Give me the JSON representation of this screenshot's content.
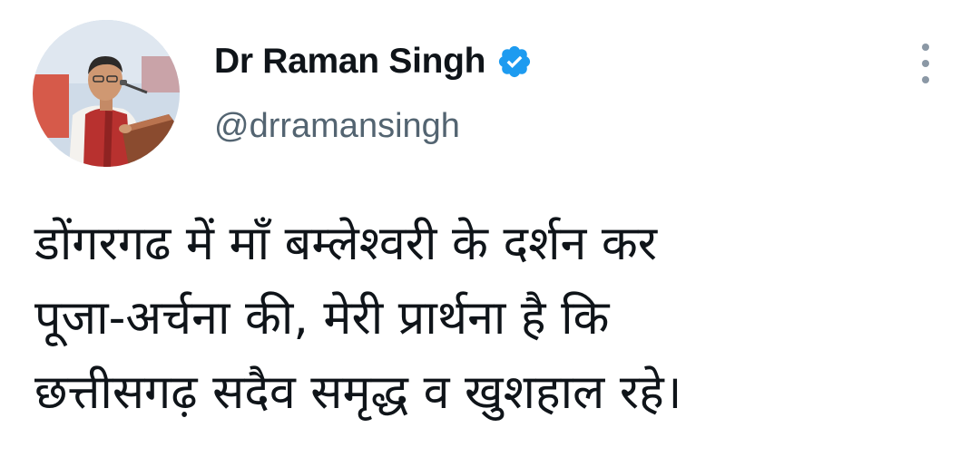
{
  "author": {
    "display_name": "Dr Raman Singh",
    "handle": "@drramansingh",
    "verified": true,
    "verified_icon": "verified-badge-icon",
    "verified_color": "#1d9bf0"
  },
  "menu": {
    "icon": "more-vertical-icon"
  },
  "tweet": {
    "lines": [
      "डोंगरगढ में माँ बम्लेश्वरी के दर्शन कर",
      "पूजा-अर्चना की, मेरी प्रार्थना है कि",
      "छत्तीसगढ़ सदैव समृद्ध व खुशहाल रहे।"
    ]
  },
  "colors": {
    "text_primary": "#0f1419",
    "text_secondary": "#536471",
    "background": "#ffffff"
  }
}
